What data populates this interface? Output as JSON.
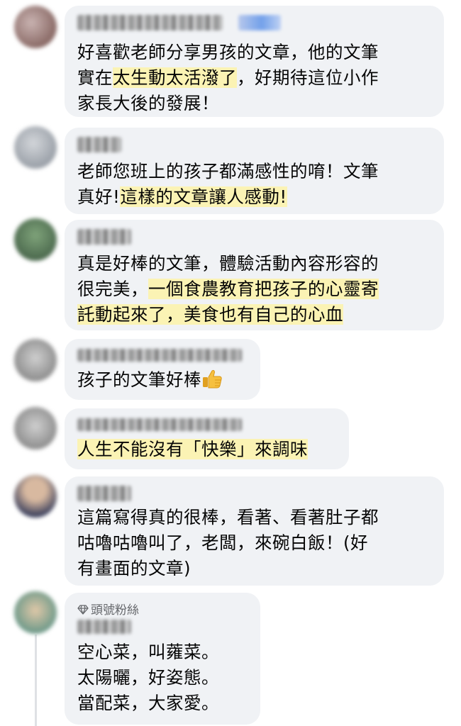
{
  "comments": [
    {
      "lines": [
        [
          {
            "t": "好喜歡老師分享男孩的文章，他的文筆",
            "h": false
          }
        ],
        [
          {
            "t": "實在",
            "h": false
          },
          {
            "t": "太生動太活潑了",
            "h": true
          },
          {
            "t": "，好期待這位小作",
            "h": false
          }
        ],
        [
          {
            "t": "家長大後的發展！",
            "h": false
          }
        ]
      ],
      "avatar_colors": [
        "#8a6a66",
        "#c9b3b1"
      ]
    },
    {
      "lines": [
        [
          {
            "t": "老師您班上的孩子都滿感性的唷！文筆",
            "h": false
          }
        ],
        [
          {
            "t": "真好!",
            "h": false
          },
          {
            "t": "這樣的文章讓人感動!",
            "h": true
          }
        ]
      ],
      "avatar_colors": [
        "#9aa0a8",
        "#d3d6da"
      ]
    },
    {
      "lines": [
        [
          {
            "t": "真是好棒的文筆，體驗活動內容形容的",
            "h": false
          }
        ],
        [
          {
            "t": "很完美，",
            "h": false
          },
          {
            "t": "一個食農教育把孩子的心靈寄",
            "h": true
          }
        ],
        [
          {
            "t": "託動起來了，美食也有自己的心血",
            "h": true
          }
        ]
      ],
      "avatar_colors": [
        "#4d6b4f",
        "#7fa37a"
      ]
    },
    {
      "lines": [
        [
          {
            "t": "孩子的文筆好棒",
            "h": false
          }
        ]
      ],
      "emoji": "thumbs-up",
      "avatar_colors": [
        "#8f8f8f",
        "#cfcfcf"
      ]
    },
    {
      "lines": [
        [
          {
            "t": "人生不能沒有「快樂」來調味",
            "h": true
          }
        ]
      ],
      "avatar_colors": [
        "#8f8f8f",
        "#cfcfcf"
      ]
    },
    {
      "lines": [
        [
          {
            "t": "這篇寫得真的很棒，看著、看著肚子都",
            "h": false
          }
        ],
        [
          {
            "t": "咕嚕咕嚕叫了，老闆，來碗白飯！(好",
            "h": false
          }
        ],
        [
          {
            "t": "有畫面的文章)",
            "h": false
          }
        ]
      ],
      "avatar_colors": [
        "#3a3f5c",
        "#d8b9a0"
      ]
    },
    {
      "badge": "頭號粉絲",
      "lines": [
        [
          {
            "t": "空心菜，叫蕹菜。",
            "h": false
          }
        ],
        [
          {
            "t": "太陽曬，好姿態。",
            "h": false
          }
        ],
        [
          {
            "t": "當配菜，大家愛。",
            "h": false
          }
        ]
      ],
      "avatar_colors": [
        "#6f9a8a",
        "#e0c8a8"
      ]
    }
  ]
}
